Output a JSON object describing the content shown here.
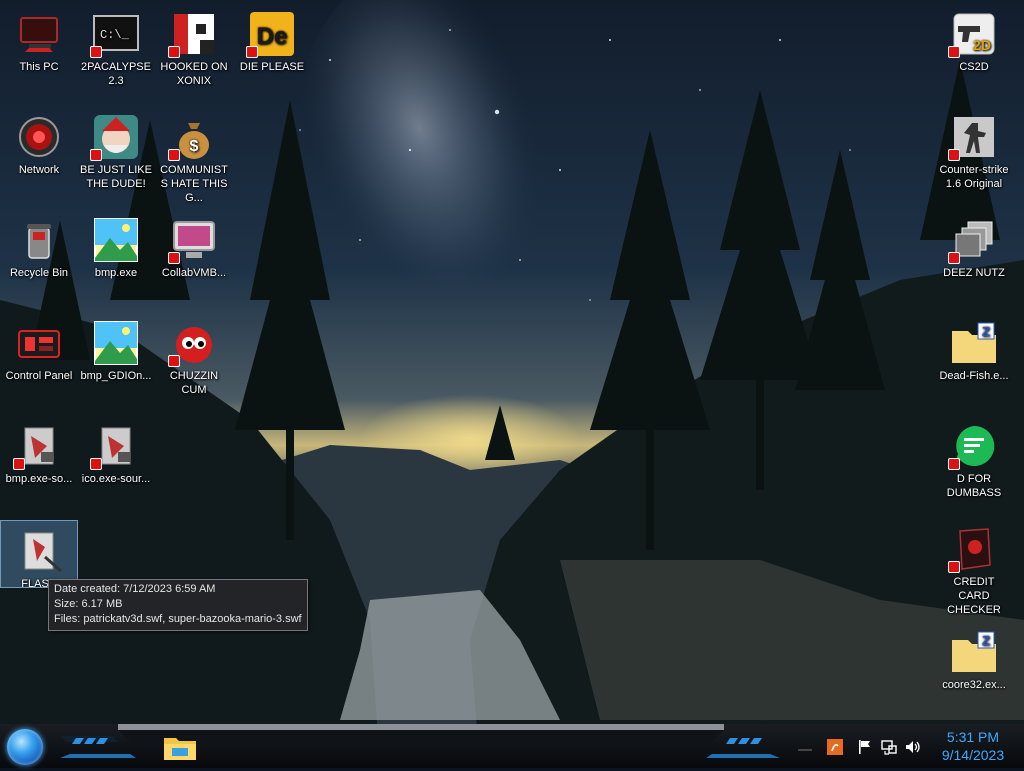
{
  "desktop": {
    "icons": [
      {
        "label": "This PC"
      },
      {
        "label": "2PACALYPSE 2.3"
      },
      {
        "label": "HOOKED ON XONIX"
      },
      {
        "label": "DIE PLEASE"
      },
      {
        "label": "Network"
      },
      {
        "label": "BE JUST LIKE THE DUDE!"
      },
      {
        "label": "COMMUNISTS HATE THIS G..."
      },
      {
        "label": "Recycle Bin"
      },
      {
        "label": "bmp.exe"
      },
      {
        "label": "CollabVMB..."
      },
      {
        "label": "Control Panel"
      },
      {
        "label": "bmp_GDIOn..."
      },
      {
        "label": "CHUZZIN CUM"
      },
      {
        "label": "bmp.exe-so..."
      },
      {
        "label": "ico.exe-sour..."
      },
      {
        "label": "FLASH"
      },
      {
        "label": "CS2D"
      },
      {
        "label": "Counter-strike 1.6 Original"
      },
      {
        "label": "DEEZ NUTZ"
      },
      {
        "label": "Dead-Fish.e..."
      },
      {
        "label": "D FOR DUMBASS"
      },
      {
        "label": "CREDIT CARD CHECKER"
      },
      {
        "label": "coore32.ex..."
      }
    ],
    "die_please_logo_text": "De"
  },
  "tooltip": {
    "date_created": "Date created: 7/12/2023 6:59 AM",
    "size": "Size: 6.17 MB",
    "files": "Files: patrickatv3d.swf, super-bazooka-mario-3.swf"
  },
  "taskbar": {
    "pinned": [
      "file-explorer-icon"
    ],
    "tray_icons": [
      "network-hidden-icon",
      "java-update-icon",
      "action-center-flag-icon",
      "network-icon",
      "volume-icon"
    ],
    "clock": {
      "time": "5:31 PM",
      "date": "9/14/2023"
    },
    "accent_color": "#3ea9ff"
  }
}
